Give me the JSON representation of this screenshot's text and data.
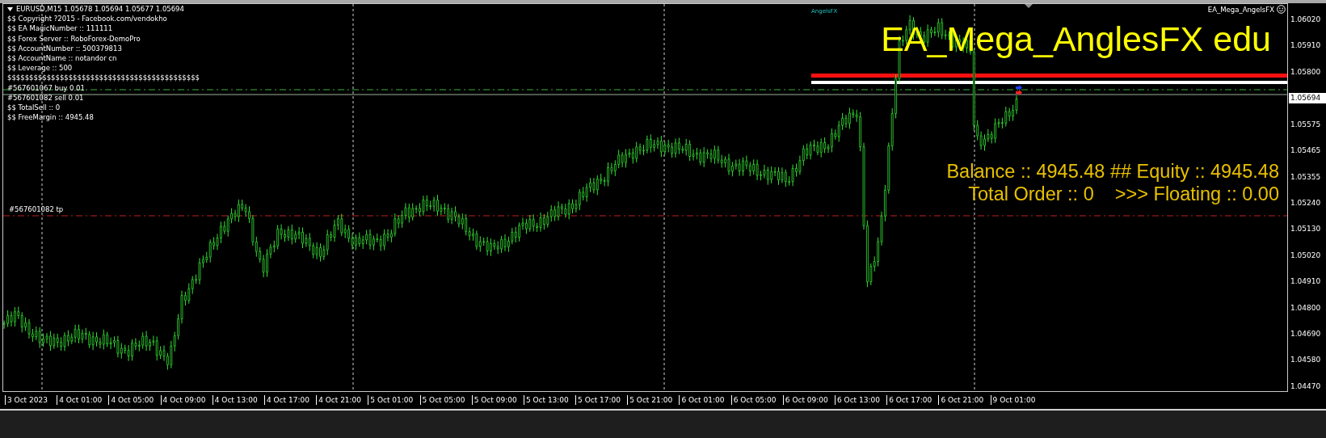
{
  "symbol_header": "EURUSD,M15  1.05678 1.05694 1.05677 1.05694",
  "info_lines": [
    "$$ Copyright ?2015 - Facebook.com/vendokho",
    "$$ EA MagicNumber :: 111111",
    "$$ Forex Server :: RoboForex-DemoPro",
    "$$ AccountNumber :: 500379813",
    "$$ AccountName :: notandor cn",
    "$$ Leverage :: 500",
    "$$$$$$$$$$$$$$$$$$$$$$$$$$$$$$$$$$$$$$$$$$$$"
  ],
  "order_labels": [
    "#567601067 buy 0.01",
    "#567601082 sell 0.01"
  ],
  "info_lines_after": [
    "$$ TotalSell :: 0",
    "$$ FreeMargin :: 4945.48"
  ],
  "indicator_label": "AngelsFX",
  "expert_name": "EA_Mega_AngelsFX",
  "chart_title": "EA_Mega_AnglesFX edu",
  "account_summary": [
    "Balance :: 4945.48 ## Equity :: 4945.48",
    "Total Order :: 0    >>> Floating :: 0.00"
  ],
  "tp_label": "#567601082 tp",
  "price_axis": [
    {
      "text": "1.06020",
      "kind": "tick"
    },
    {
      "text": "1.05910",
      "kind": "tick"
    },
    {
      "text": "1.05800",
      "kind": "tick"
    },
    {
      "text": "1.05694",
      "kind": "current"
    },
    {
      "text": "1.05575",
      "kind": "tick"
    },
    {
      "text": "1.05465",
      "kind": "tick"
    },
    {
      "text": "1.05355",
      "kind": "tick"
    },
    {
      "text": "1.05240",
      "kind": "tick"
    },
    {
      "text": "1.05130",
      "kind": "tick"
    },
    {
      "text": "1.05020",
      "kind": "tick"
    },
    {
      "text": "1.04910",
      "kind": "tick"
    },
    {
      "text": "1.04800",
      "kind": "tick"
    },
    {
      "text": "1.04690",
      "kind": "tick"
    },
    {
      "text": "1.04580",
      "kind": "tick"
    },
    {
      "text": "1.04470",
      "kind": "tick"
    }
  ],
  "time_axis": [
    "3 Oct 2023",
    "4 Oct 01:00",
    "4 Oct 05:00",
    "4 Oct 09:00",
    "4 Oct 13:00",
    "4 Oct 17:00",
    "4 Oct 21:00",
    "5 Oct 01:00",
    "5 Oct 05:00",
    "5 Oct 09:00",
    "5 Oct 13:00",
    "5 Oct 17:00",
    "5 Oct 21:00",
    "6 Oct 01:00",
    "6 Oct 05:00",
    "6 Oct 09:00",
    "6 Oct 13:00",
    "6 Oct 17:00",
    "6 Oct 21:00",
    "9 Oct 01:00"
  ]
}
